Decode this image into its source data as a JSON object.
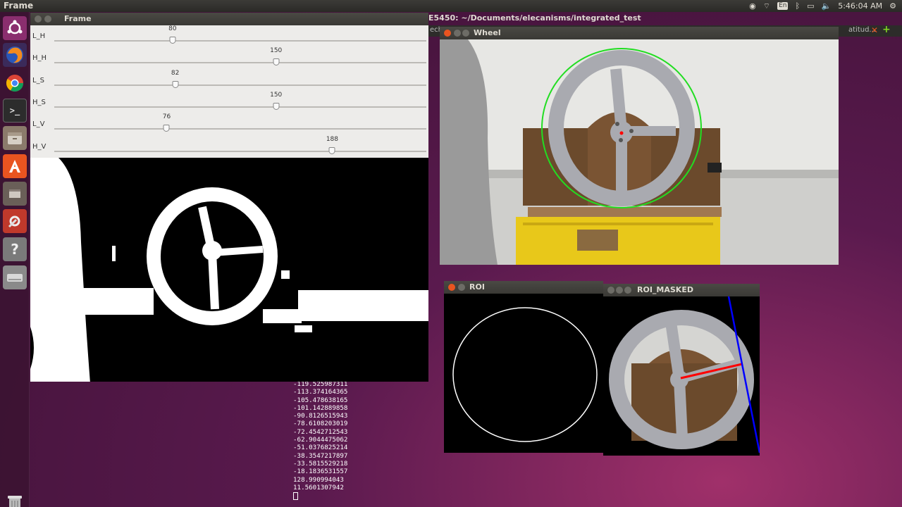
{
  "top_panel": {
    "app_title": "Frame",
    "clock": "5:46:04 AM",
    "keyboard_layout": "En"
  },
  "frame_window": {
    "title": "Frame",
    "sliders": [
      {
        "label": "L_H",
        "value": "80",
        "fraction": 0.318
      },
      {
        "label": "H_H",
        "value": "150",
        "fraction": 0.596
      },
      {
        "label": "L_S",
        "value": "82",
        "fraction": 0.325
      },
      {
        "label": "H_S",
        "value": "150",
        "fraction": 0.596
      },
      {
        "label": "L_V",
        "value": "76",
        "fraction": 0.302
      },
      {
        "label": "H_V",
        "value": "188",
        "fraction": 0.747
      }
    ]
  },
  "terminal": {
    "title": "E5450: ~/Documents/elecanisms/integrated_test",
    "tab_partial_left": "ech",
    "tab_partial_right": "atitud...",
    "lines": [
      "-119.525987311",
      "-113.374164365",
      "-105.478638165",
      "-101.142889858",
      "-90.8126515943",
      "-78.6108203019",
      "-72.4542712543",
      "-62.9044475062",
      "-51.0376825214",
      "-38.3547217897",
      "-33.5815529218",
      "-18.1836531557",
      "128.990994043",
      "11.5601307942"
    ]
  },
  "wheel_window": {
    "title": "Wheel"
  },
  "roi_window": {
    "title": "ROI"
  },
  "roi_masked_window": {
    "title": "ROI_MASKED"
  },
  "colors": {
    "ubuntu_orange": "#e95420",
    "detect_green": "#22dd22",
    "angle_red": "#ff0000",
    "edge_blue": "#0000ff"
  }
}
